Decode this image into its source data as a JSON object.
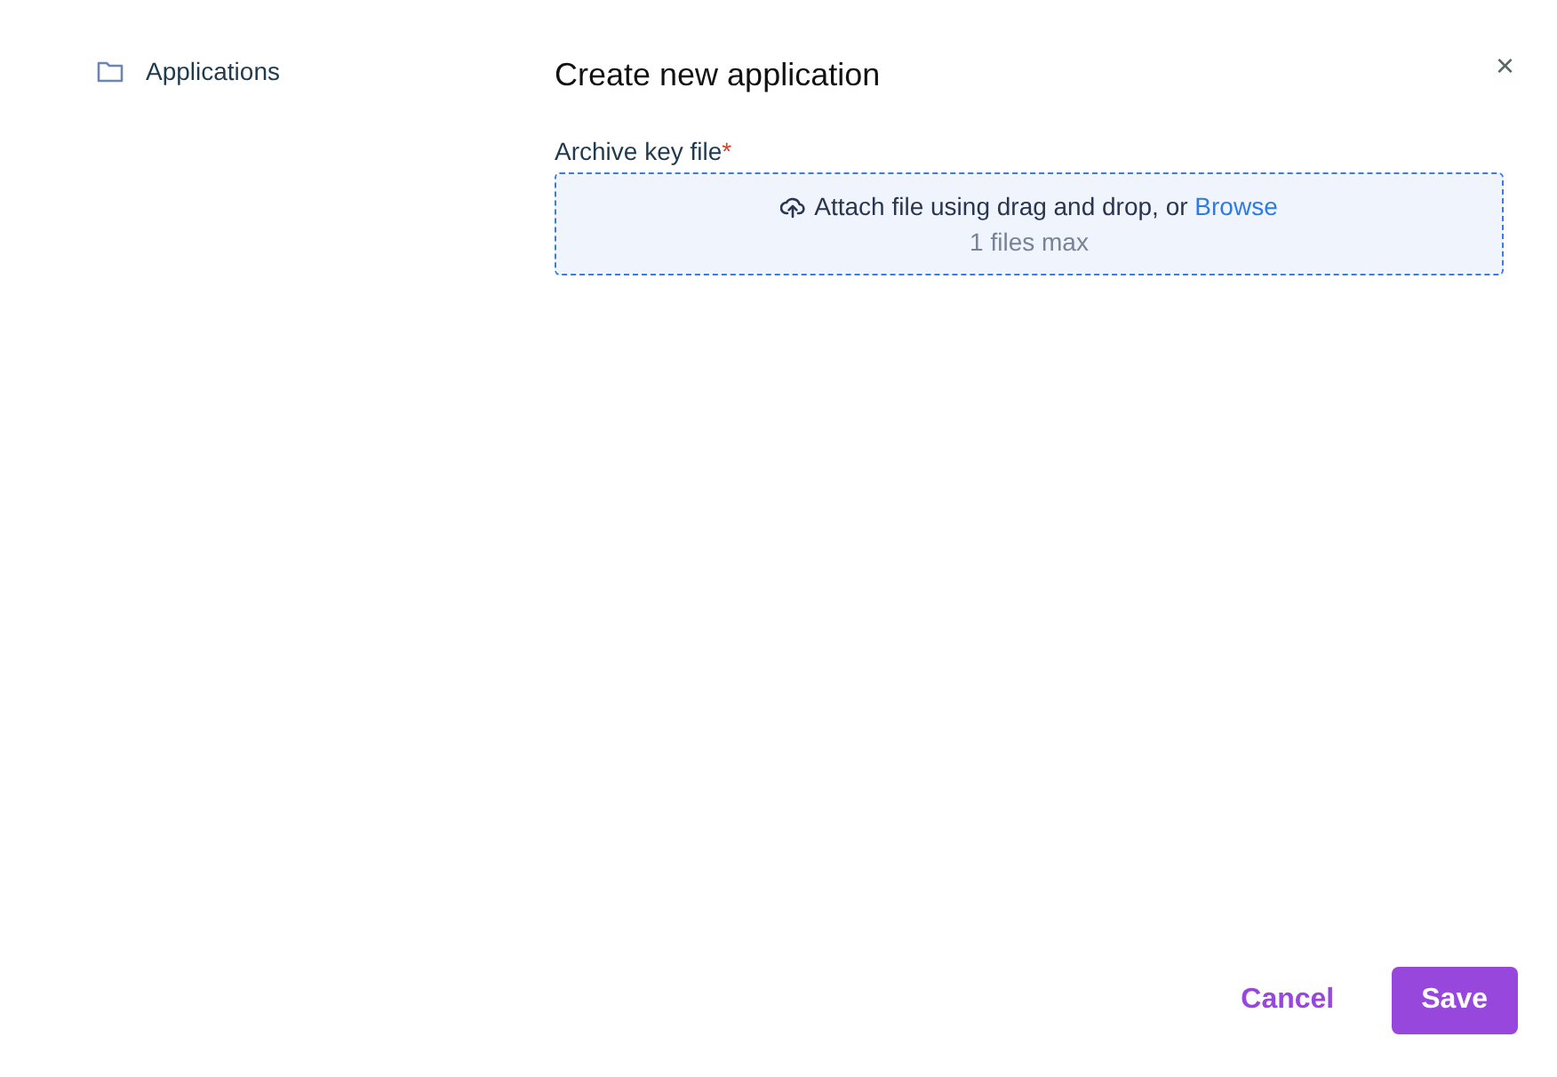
{
  "sidebar": {
    "items": [
      {
        "label": "Applications",
        "selected": false
      }
    ]
  },
  "dialog": {
    "title": "Create new application",
    "close": "×",
    "field": {
      "label": "Archive key file",
      "required_mark": "*",
      "dropzone": {
        "text": "Attach file using drag and drop, or ",
        "link": "Browse",
        "hint": "1 files max"
      }
    },
    "buttons": [
      {
        "label": "Cancel",
        "kind": "text"
      },
      {
        "label": "Save",
        "kind": "primary"
      }
    ]
  }
}
